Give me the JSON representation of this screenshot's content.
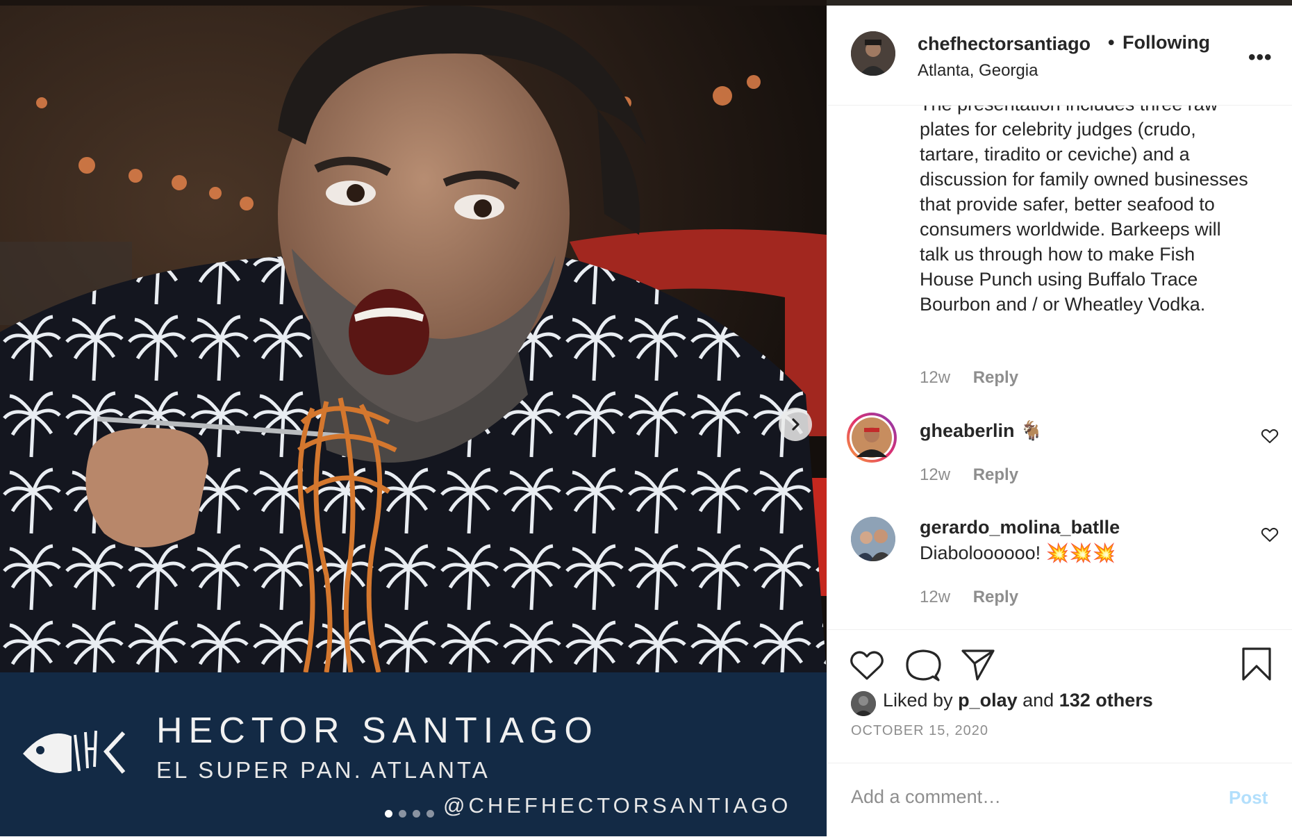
{
  "post": {
    "author": "chefhectorsantiago",
    "separator": "•",
    "follow_status": "Following",
    "location": "Atlanta, Georgia",
    "more_icon": "more-horizontal-icon",
    "more_label": "•••"
  },
  "media": {
    "banner_name": "HECTOR SANTIAGO",
    "banner_subtitle": "EL SUPER PAN. ATLANTA",
    "banner_handle": "@CHEFHECTORSANTIAGO",
    "carousel_count": 4,
    "carousel_active": 1,
    "next_icon": "chevron-right-icon",
    "banner_color": "#132a45"
  },
  "caption": {
    "text": "The presentation includes three raw plates for celebrity judges (crudo, tartare, tiradito or ceviche) and a discussion for family owned businesses that provide safer, better seafood to consumers worldwide. Barkeeps will talk us through how to make Fish House Punch using Buffalo Trace Bourbon and / or Wheatley Vodka.",
    "age": "12w",
    "reply": "Reply"
  },
  "comments": [
    {
      "user": "gheaberlin",
      "emoji": "🐐",
      "text": "",
      "age": "12w",
      "reply": "Reply"
    },
    {
      "user": "gerardo_molina_batlle",
      "text": "Diaboloooooo! 💥💥💥",
      "age": "12w",
      "reply": "Reply"
    }
  ],
  "actions": {
    "liked_by_prefix": "Liked by ",
    "liked_by_user": "p_olay",
    "liked_by_mid": " and ",
    "liked_by_others": "132 others",
    "date": "OCTOBER 15, 2020"
  },
  "add_comment": {
    "placeholder": "Add a comment…",
    "post_label": "Post"
  },
  "colors": {
    "text": "#262626",
    "muted": "#8e8e8e",
    "post_disabled": "#b2dffc",
    "border": "#efefef"
  }
}
